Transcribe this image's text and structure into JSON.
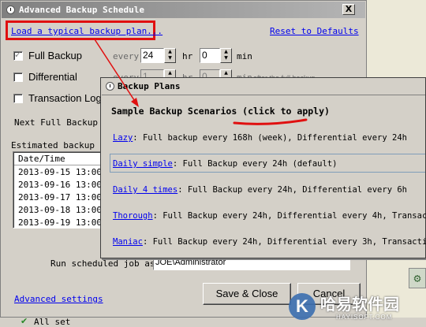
{
  "window": {
    "title": "Advanced Backup Schedule",
    "close_label": "X"
  },
  "top_links": {
    "load_plan": "Load a typical backup plan...",
    "reset": "Reset to Defaults"
  },
  "backup_types": [
    {
      "label": "Full Backup",
      "checked": true,
      "every_label": "every",
      "hours": "24",
      "hr_label": "hr",
      "minutes": "0",
      "min_label": "min"
    },
    {
      "label": "Differential",
      "checked": false,
      "every_label": "every",
      "hours": "1",
      "hr_label": "hr",
      "minutes": "0",
      "min_label": "min",
      "suffix": "after the full backup"
    },
    {
      "label": "Transaction Log",
      "checked": false
    }
  ],
  "next_backup_label": "Next Full Backup S",
  "estimated_label": "Estimated backup pl",
  "schedule_table": {
    "header": "Date/Time",
    "rows": [
      "2013-09-15  13:00",
      "2013-09-16  13:00",
      "2013-09-17  13:00",
      "2013-09-18  13:00",
      "2013-09-19  13:00"
    ]
  },
  "run_as": {
    "label": "Run scheduled job as:",
    "value": "JOE\\Administrator"
  },
  "bottom": {
    "advanced_link": "Advanced settings",
    "save_button": "Save & Close",
    "cancel_button": "Cancel"
  },
  "status": {
    "text": "All set"
  },
  "popup": {
    "title": "Backup Plans",
    "heading": "Sample Backup Scenarios (click to apply)",
    "scenarios": [
      {
        "name": "Lazy",
        "desc": ": Full backup every 168h (week), Differential every 24h"
      },
      {
        "name": "Daily simple",
        "desc": ": Full Backup every 24h (default)"
      },
      {
        "name": "Daily 4 times",
        "desc": ":  Full Backup every 24h, Differential every 6h"
      },
      {
        "name": "Thorough",
        "desc": ": Full Backup every 24h, Differential every 4h, Transaction"
      },
      {
        "name": "Maniac",
        "desc": ": Full Backup every 24h, Differential every 3h, Transaction"
      }
    ]
  },
  "watermark": {
    "brand": "哈易软件园",
    "url": "HAYISOFT.COM"
  },
  "colors": {
    "annotation_red": "#e01010",
    "link_blue": "#0000ee",
    "dialog_grey": "#d4d0c8"
  }
}
